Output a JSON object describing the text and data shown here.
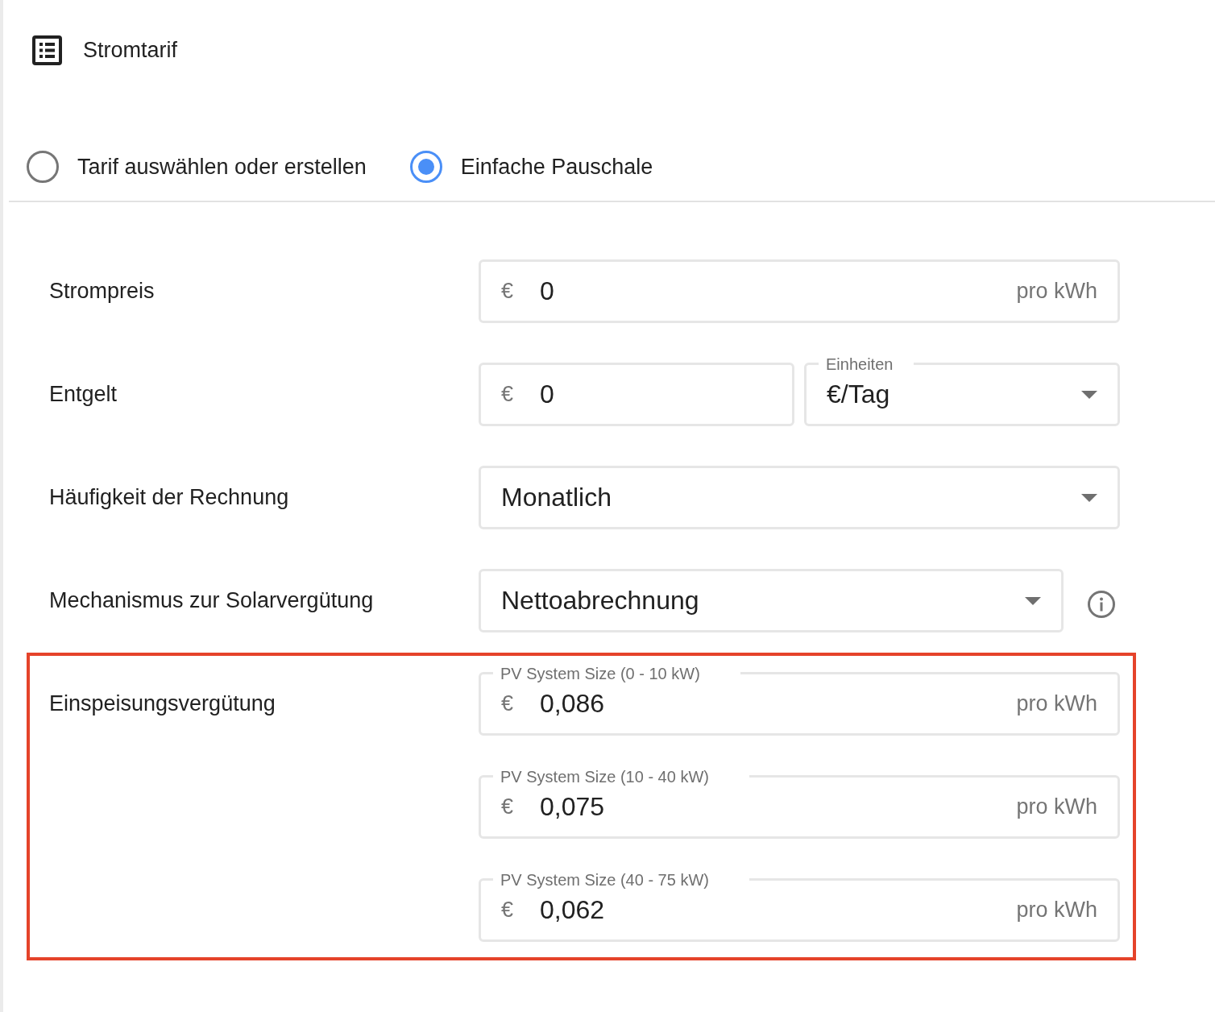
{
  "header": {
    "title": "Stromtarif"
  },
  "tariff_mode": [
    {
      "label": "Tarif auswählen oder erstellen",
      "selected": false
    },
    {
      "label": "Einfache Pauschale",
      "selected": true
    }
  ],
  "rows": [
    {
      "label": "Strompreis",
      "kind": "single",
      "highlighted": false,
      "info_button": false,
      "fields": [
        {
          "kind": "input",
          "prefix": "€",
          "value": "0",
          "suffix": "pro kWh"
        }
      ]
    },
    {
      "label": "Entgelt",
      "kind": "split",
      "highlighted": false,
      "info_button": false,
      "fields": [
        {
          "kind": "input",
          "prefix": "€",
          "value": "0"
        },
        {
          "kind": "select",
          "legend": "Einheiten",
          "value": "€/Tag"
        }
      ]
    },
    {
      "label": "Häufigkeit der Rechnung",
      "kind": "single",
      "highlighted": false,
      "info_button": false,
      "fields": [
        {
          "kind": "select",
          "value": "Monatlich"
        }
      ]
    },
    {
      "label": "Mechanismus zur Solarvergütung",
      "kind": "single",
      "highlighted": false,
      "info_button": true,
      "fields": [
        {
          "kind": "select",
          "value": "Nettoabrechnung"
        }
      ]
    },
    {
      "label": "Einspeisungsvergütung",
      "kind": "stacked",
      "highlighted": true,
      "info_button": false,
      "fields": [
        {
          "kind": "input",
          "legend": "PV System Size (0 - 10 kW)",
          "prefix": "€",
          "value": "0,086",
          "suffix": "pro kWh"
        },
        {
          "kind": "input",
          "legend": "PV System Size (10 - 40 kW)",
          "prefix": "€",
          "value": "0,075",
          "suffix": "pro kWh"
        },
        {
          "kind": "input",
          "legend": "PV System Size (40 - 75 kW)",
          "prefix": "€",
          "value": "0,062",
          "suffix": "pro kWh"
        }
      ]
    }
  ]
}
